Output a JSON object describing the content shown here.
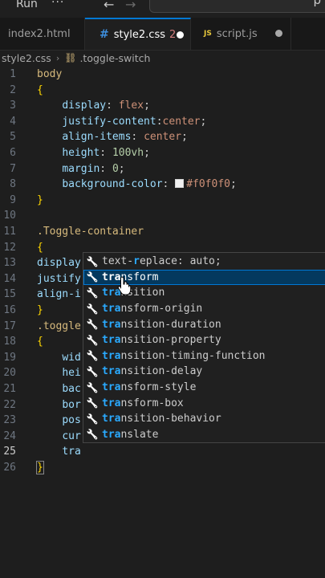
{
  "titlebar": {
    "run_label": "Run",
    "more_label": "···",
    "search_glyph": "ρ"
  },
  "tabs": [
    {
      "label": "index2.html"
    },
    {
      "label": "style2.css",
      "problems": "2"
    },
    {
      "label": "script.js",
      "icon_text": "JS"
    }
  ],
  "breadcrumb": {
    "file": "style2.css",
    "symbol": ".toggle-switch"
  },
  "editor": {
    "current_line": 25,
    "lines": [
      {
        "n": "1",
        "t": [
          [
            "sel",
            "body"
          ]
        ]
      },
      {
        "n": "2",
        "t": [
          [
            "br",
            "{"
          ]
        ]
      },
      {
        "n": "3",
        "t": [
          [
            "sp",
            "    "
          ],
          [
            "prop",
            "display"
          ],
          [
            "punc",
            ": "
          ],
          [
            "val",
            "flex"
          ],
          [
            "punc",
            ";"
          ]
        ]
      },
      {
        "n": "4",
        "t": [
          [
            "sp",
            "    "
          ],
          [
            "prop",
            "justify-content"
          ],
          [
            "punc",
            ":"
          ],
          [
            "val",
            "center"
          ],
          [
            "punc",
            ";"
          ]
        ]
      },
      {
        "n": "5",
        "t": [
          [
            "sp",
            "    "
          ],
          [
            "prop",
            "align-items"
          ],
          [
            "punc",
            ": "
          ],
          [
            "val",
            "center"
          ],
          [
            "punc",
            ";"
          ]
        ]
      },
      {
        "n": "6",
        "t": [
          [
            "sp",
            "    "
          ],
          [
            "prop",
            "height"
          ],
          [
            "punc",
            ": "
          ],
          [
            "num",
            "100vh"
          ],
          [
            "punc",
            ";"
          ]
        ]
      },
      {
        "n": "7",
        "t": [
          [
            "sp",
            "    "
          ],
          [
            "prop",
            "margin"
          ],
          [
            "punc",
            ": "
          ],
          [
            "num",
            "0"
          ],
          [
            "punc",
            ";"
          ]
        ]
      },
      {
        "n": "8",
        "t": [
          [
            "sp",
            "    "
          ],
          [
            "prop",
            "background-color"
          ],
          [
            "punc",
            ": "
          ],
          [
            "swatch",
            ""
          ],
          [
            "val",
            "#f0f0f0"
          ],
          [
            "punc",
            ";"
          ]
        ]
      },
      {
        "n": "9",
        "t": [
          [
            "br",
            "}"
          ]
        ]
      },
      {
        "n": "10",
        "t": []
      },
      {
        "n": "11",
        "t": [
          [
            "sel",
            ".Toggle-container"
          ]
        ]
      },
      {
        "n": "12",
        "t": [
          [
            "br",
            "{"
          ]
        ]
      },
      {
        "n": "13",
        "t": [
          [
            "prop",
            "display"
          ]
        ]
      },
      {
        "n": "14",
        "t": [
          [
            "prop",
            "justify"
          ]
        ]
      },
      {
        "n": "15",
        "t": [
          [
            "prop",
            "align-i"
          ]
        ]
      },
      {
        "n": "16",
        "t": [
          [
            "br",
            "}"
          ]
        ]
      },
      {
        "n": "17",
        "t": [
          [
            "sel",
            ".toggle"
          ]
        ]
      },
      {
        "n": "18",
        "t": [
          [
            "br",
            "{"
          ]
        ]
      },
      {
        "n": "19",
        "t": [
          [
            "sp",
            "    "
          ],
          [
            "prop",
            "wid"
          ]
        ]
      },
      {
        "n": "20",
        "t": [
          [
            "sp",
            "    "
          ],
          [
            "prop",
            "hei"
          ]
        ]
      },
      {
        "n": "21",
        "t": [
          [
            "sp",
            "    "
          ],
          [
            "prop",
            "bac"
          ]
        ]
      },
      {
        "n": "22",
        "t": [
          [
            "sp",
            "    "
          ],
          [
            "prop",
            "bor"
          ]
        ]
      },
      {
        "n": "23",
        "t": [
          [
            "sp",
            "    "
          ],
          [
            "prop",
            "pos"
          ]
        ]
      },
      {
        "n": "24",
        "t": [
          [
            "sp",
            "    "
          ],
          [
            "prop",
            "cur"
          ]
        ]
      },
      {
        "n": "25",
        "t": [
          [
            "sp",
            "    "
          ],
          [
            "prop",
            "tra"
          ]
        ]
      },
      {
        "n": "26",
        "t": [
          [
            "brm",
            "}"
          ]
        ]
      }
    ]
  },
  "suggestions": {
    "active_index": 1,
    "items": [
      {
        "pre": "text-",
        "hl": "r",
        "post": "eplace: auto;"
      },
      {
        "pre": "",
        "hl": "tra",
        "post": "nsform"
      },
      {
        "pre": "",
        "hl": "tra",
        "post": "nsition"
      },
      {
        "pre": "",
        "hl": "tra",
        "post": "nsform-origin"
      },
      {
        "pre": "",
        "hl": "tra",
        "post": "nsition-duration"
      },
      {
        "pre": "",
        "hl": "tra",
        "post": "nsition-property"
      },
      {
        "pre": "",
        "hl": "tra",
        "post": "nsition-timing-function"
      },
      {
        "pre": "",
        "hl": "tra",
        "post": "nsition-delay"
      },
      {
        "pre": "",
        "hl": "tra",
        "post": "nsform-style"
      },
      {
        "pre": "",
        "hl": "tra",
        "post": "nsform-box"
      },
      {
        "pre": "",
        "hl": "tra",
        "post": "nsition-behavior"
      },
      {
        "pre": "",
        "hl": "tra",
        "post": "nslate"
      }
    ]
  },
  "colors": {
    "accent": "#0078d4",
    "editor_bg": "#1e1e1e",
    "selector": "#d7ba7d",
    "property": "#9cdcfe",
    "value": "#ce9178",
    "number": "#b5cea8",
    "bracket": "#ffd700",
    "match_highlight": "#2aaaff"
  }
}
